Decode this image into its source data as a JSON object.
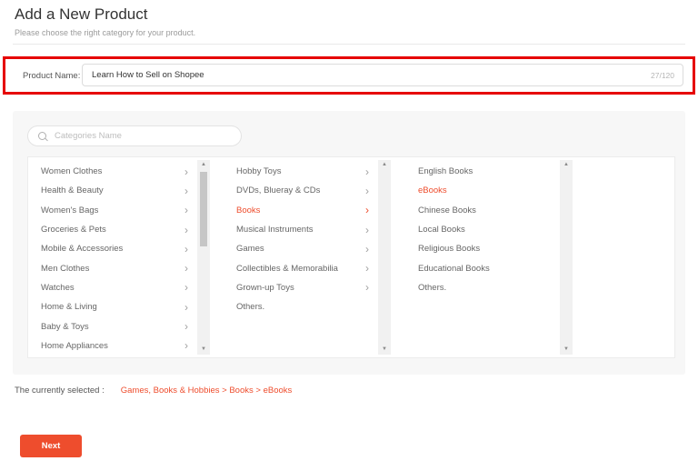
{
  "page": {
    "title": "Add a New Product",
    "subtitle": "Please choose the right category for your product."
  },
  "product_name": {
    "label": "Product Name:",
    "value": "Learn How to Sell on Shopee",
    "counter": "27/120"
  },
  "search": {
    "placeholder": "Categories Name",
    "icon": "magnifier-icon"
  },
  "categories": {
    "columns": [
      {
        "scrollbar": {
          "thumb": true
        },
        "items": [
          {
            "label": "Women Clothes",
            "has_children": true,
            "selected": false
          },
          {
            "label": "Health & Beauty",
            "has_children": true,
            "selected": false
          },
          {
            "label": "Women's Bags",
            "has_children": true,
            "selected": false
          },
          {
            "label": "Groceries & Pets",
            "has_children": true,
            "selected": false
          },
          {
            "label": "Mobile & Accessories",
            "has_children": true,
            "selected": false
          },
          {
            "label": "Men Clothes",
            "has_children": true,
            "selected": false
          },
          {
            "label": "Watches",
            "has_children": true,
            "selected": false
          },
          {
            "label": "Home & Living",
            "has_children": true,
            "selected": false
          },
          {
            "label": "Baby & Toys",
            "has_children": true,
            "selected": false
          },
          {
            "label": "Home Appliances",
            "has_children": true,
            "selected": false
          }
        ]
      },
      {
        "scrollbar": {
          "thumb": false
        },
        "items": [
          {
            "label": "Hobby Toys",
            "has_children": true,
            "selected": false
          },
          {
            "label": "DVDs, Blueray & CDs",
            "has_children": true,
            "selected": false
          },
          {
            "label": "Books",
            "has_children": true,
            "selected": true
          },
          {
            "label": "Musical Instruments",
            "has_children": true,
            "selected": false
          },
          {
            "label": "Games",
            "has_children": true,
            "selected": false
          },
          {
            "label": "Collectibles & Memorabilia",
            "has_children": true,
            "selected": false
          },
          {
            "label": "Grown-up Toys",
            "has_children": true,
            "selected": false
          },
          {
            "label": "Others.",
            "has_children": false,
            "selected": false
          }
        ]
      },
      {
        "scrollbar": {
          "thumb": false
        },
        "items": [
          {
            "label": "English Books",
            "has_children": false,
            "selected": false
          },
          {
            "label": "eBooks",
            "has_children": false,
            "selected": true
          },
          {
            "label": "Chinese Books",
            "has_children": false,
            "selected": false
          },
          {
            "label": "Local Books",
            "has_children": false,
            "selected": false
          },
          {
            "label": "Religious Books",
            "has_children": false,
            "selected": false
          },
          {
            "label": "Educational Books",
            "has_children": false,
            "selected": false
          },
          {
            "label": "Others.",
            "has_children": false,
            "selected": false
          }
        ]
      }
    ]
  },
  "selection": {
    "label": "The currently selected :",
    "path": "Games, Books & Hobbies > Books > eBooks"
  },
  "next_button": {
    "label": "Next"
  },
  "icons": {
    "chevron_right": "›",
    "scroll_up": "▲",
    "scroll_down": "▼"
  },
  "colors": {
    "accent": "#ee4d2d",
    "annotation_red": "#e60000",
    "panel_gray": "#f7f7f7"
  }
}
